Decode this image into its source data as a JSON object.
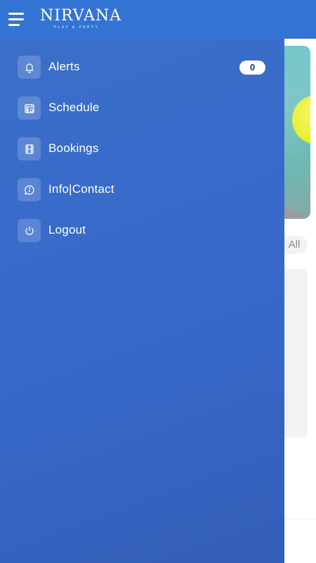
{
  "app": {
    "logo_main": "NIRVANA",
    "logo_sub": "PLAY & PARTY"
  },
  "menu": {
    "items": [
      {
        "label": "Alerts",
        "icon": "bell-icon",
        "badge": "0"
      },
      {
        "label": "Schedule",
        "icon": "calendar-icon"
      },
      {
        "label": "Bookings",
        "icon": "film-icon"
      },
      {
        "label": "Info|Contact",
        "icon": "chat-info-icon"
      },
      {
        "label": "Logout",
        "icon": "power-icon"
      }
    ]
  },
  "background": {
    "filter_label": "All"
  },
  "colors": {
    "appbar": "#3474d4",
    "drawer": "#3769cb",
    "badge_text": "#1d3f86"
  }
}
